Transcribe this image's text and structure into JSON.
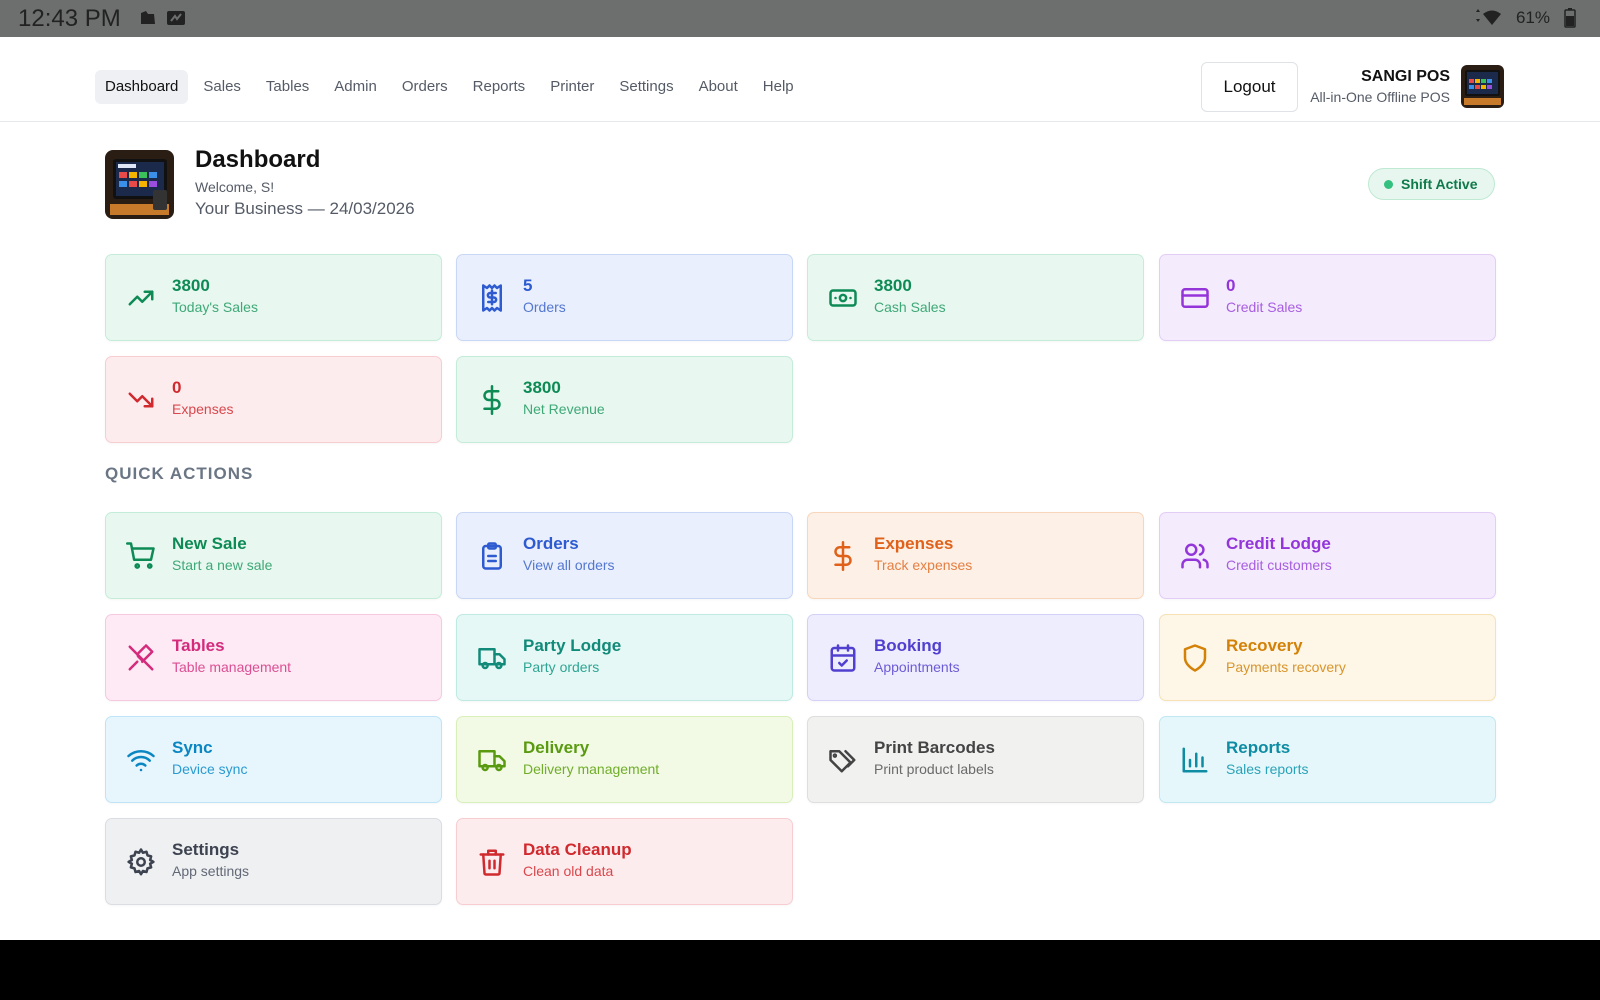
{
  "status_bar": {
    "time": "12:43 PM",
    "battery": "61%"
  },
  "nav": {
    "items": [
      {
        "label": "Dashboard",
        "active": true
      },
      {
        "label": "Sales"
      },
      {
        "label": "Tables"
      },
      {
        "label": "Admin"
      },
      {
        "label": "Orders"
      },
      {
        "label": "Reports"
      },
      {
        "label": "Printer"
      },
      {
        "label": "Settings"
      },
      {
        "label": "About"
      },
      {
        "label": "Help"
      }
    ],
    "logout_label": "Logout",
    "brand_name": "SANGI POS",
    "brand_sub": "All-in-One Offline POS"
  },
  "header": {
    "title": "Dashboard",
    "welcome": "Welcome, S!",
    "business": "Your Business — 24/03/2026",
    "shift_status": "Shift Active"
  },
  "stats": [
    {
      "value": "3800",
      "label": "Today's Sales",
      "icon": "trending-up-icon",
      "theme": "green"
    },
    {
      "value": "5",
      "label": "Orders",
      "icon": "receipt-icon",
      "theme": "blue"
    },
    {
      "value": "3800",
      "label": "Cash Sales",
      "icon": "banknote-icon",
      "theme": "green"
    },
    {
      "value": "0",
      "label": "Credit Sales",
      "icon": "credit-card-icon",
      "theme": "purple"
    },
    {
      "value": "0",
      "label": "Expenses",
      "icon": "trending-down-icon",
      "theme": "red"
    },
    {
      "value": "3800",
      "label": "Net Revenue",
      "icon": "dollar-icon",
      "theme": "green"
    }
  ],
  "quick_actions_title": "QUICK ACTIONS",
  "actions": [
    {
      "title": "New Sale",
      "subtitle": "Start a new sale",
      "icon": "cart-icon",
      "theme": "green"
    },
    {
      "title": "Orders",
      "subtitle": "View all orders",
      "icon": "clipboard-icon",
      "theme": "blue"
    },
    {
      "title": "Expenses",
      "subtitle": "Track expenses",
      "icon": "dollar-icon",
      "theme": "orange"
    },
    {
      "title": "Credit Lodge",
      "subtitle": "Credit customers",
      "icon": "users-icon",
      "theme": "purple"
    },
    {
      "title": "Tables",
      "subtitle": "Table management",
      "icon": "utensils-icon",
      "theme": "pink"
    },
    {
      "title": "Party Lodge",
      "subtitle": "Party orders",
      "icon": "truck-icon",
      "theme": "teal"
    },
    {
      "title": "Booking",
      "subtitle": "Appointments",
      "icon": "calendar-check-icon",
      "theme": "indigo"
    },
    {
      "title": "Recovery",
      "subtitle": "Payments recovery",
      "icon": "shield-icon",
      "theme": "amber"
    },
    {
      "title": "Sync",
      "subtitle": "Device sync",
      "icon": "wifi-icon",
      "theme": "sky"
    },
    {
      "title": "Delivery",
      "subtitle": "Delivery management",
      "icon": "truck-icon",
      "theme": "lime"
    },
    {
      "title": "Print Barcodes",
      "subtitle": "Print product labels",
      "icon": "tags-icon",
      "theme": "gray"
    },
    {
      "title": "Reports",
      "subtitle": "Sales reports",
      "icon": "bar-chart-icon",
      "theme": "cyan"
    },
    {
      "title": "Settings",
      "subtitle": "App settings",
      "icon": "gear-icon",
      "theme": "slate"
    },
    {
      "title": "Data Cleanup",
      "subtitle": "Clean old data",
      "icon": "trash-icon",
      "theme": "red"
    }
  ]
}
